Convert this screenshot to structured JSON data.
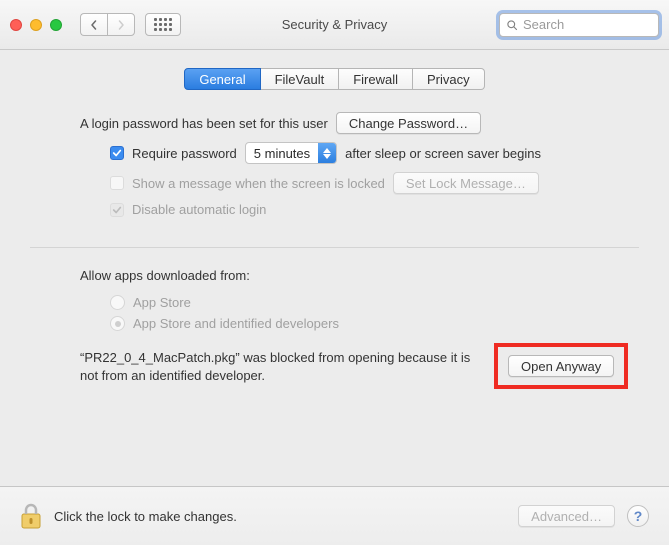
{
  "window": {
    "title": "Security & Privacy"
  },
  "search": {
    "placeholder": "Search"
  },
  "tabs": [
    {
      "label": "General",
      "active": true
    },
    {
      "label": "FileVault",
      "active": false
    },
    {
      "label": "Firewall",
      "active": false
    },
    {
      "label": "Privacy",
      "active": false
    }
  ],
  "password": {
    "status_text": "A login password has been set for this user",
    "change_button": "Change Password…",
    "require_label_before": "Require password",
    "require_dropdown": "5 minutes",
    "require_label_after": "after sleep or screen saver begins",
    "show_message_label": "Show a message when the screen is locked",
    "set_lock_button": "Set Lock Message…",
    "disable_auto_login": "Disable automatic login"
  },
  "downloads": {
    "section_label": "Allow apps downloaded from:",
    "option_appstore": "App Store",
    "option_identified": "App Store and identified developers",
    "blocked_message": "“PR22_0_4_MacPatch.pkg” was blocked from opening because it is not from an identified developer.",
    "open_anyway_button": "Open Anyway"
  },
  "footer": {
    "lock_text": "Click the lock to make changes.",
    "advanced_button": "Advanced…"
  }
}
